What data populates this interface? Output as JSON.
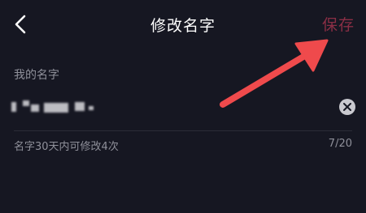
{
  "header": {
    "back_icon": "chevron-left-icon",
    "title": "修改名字",
    "save_label": "保存"
  },
  "form": {
    "section_label": "我的名字",
    "name_value": "",
    "clear_icon": "clear-circle-icon",
    "hint": "名字30天内可修改4次",
    "counter": "7/20"
  },
  "colors": {
    "background": "#161722",
    "save_disabled": "#8a2e45",
    "annotation_arrow": "#ef4a4c"
  }
}
